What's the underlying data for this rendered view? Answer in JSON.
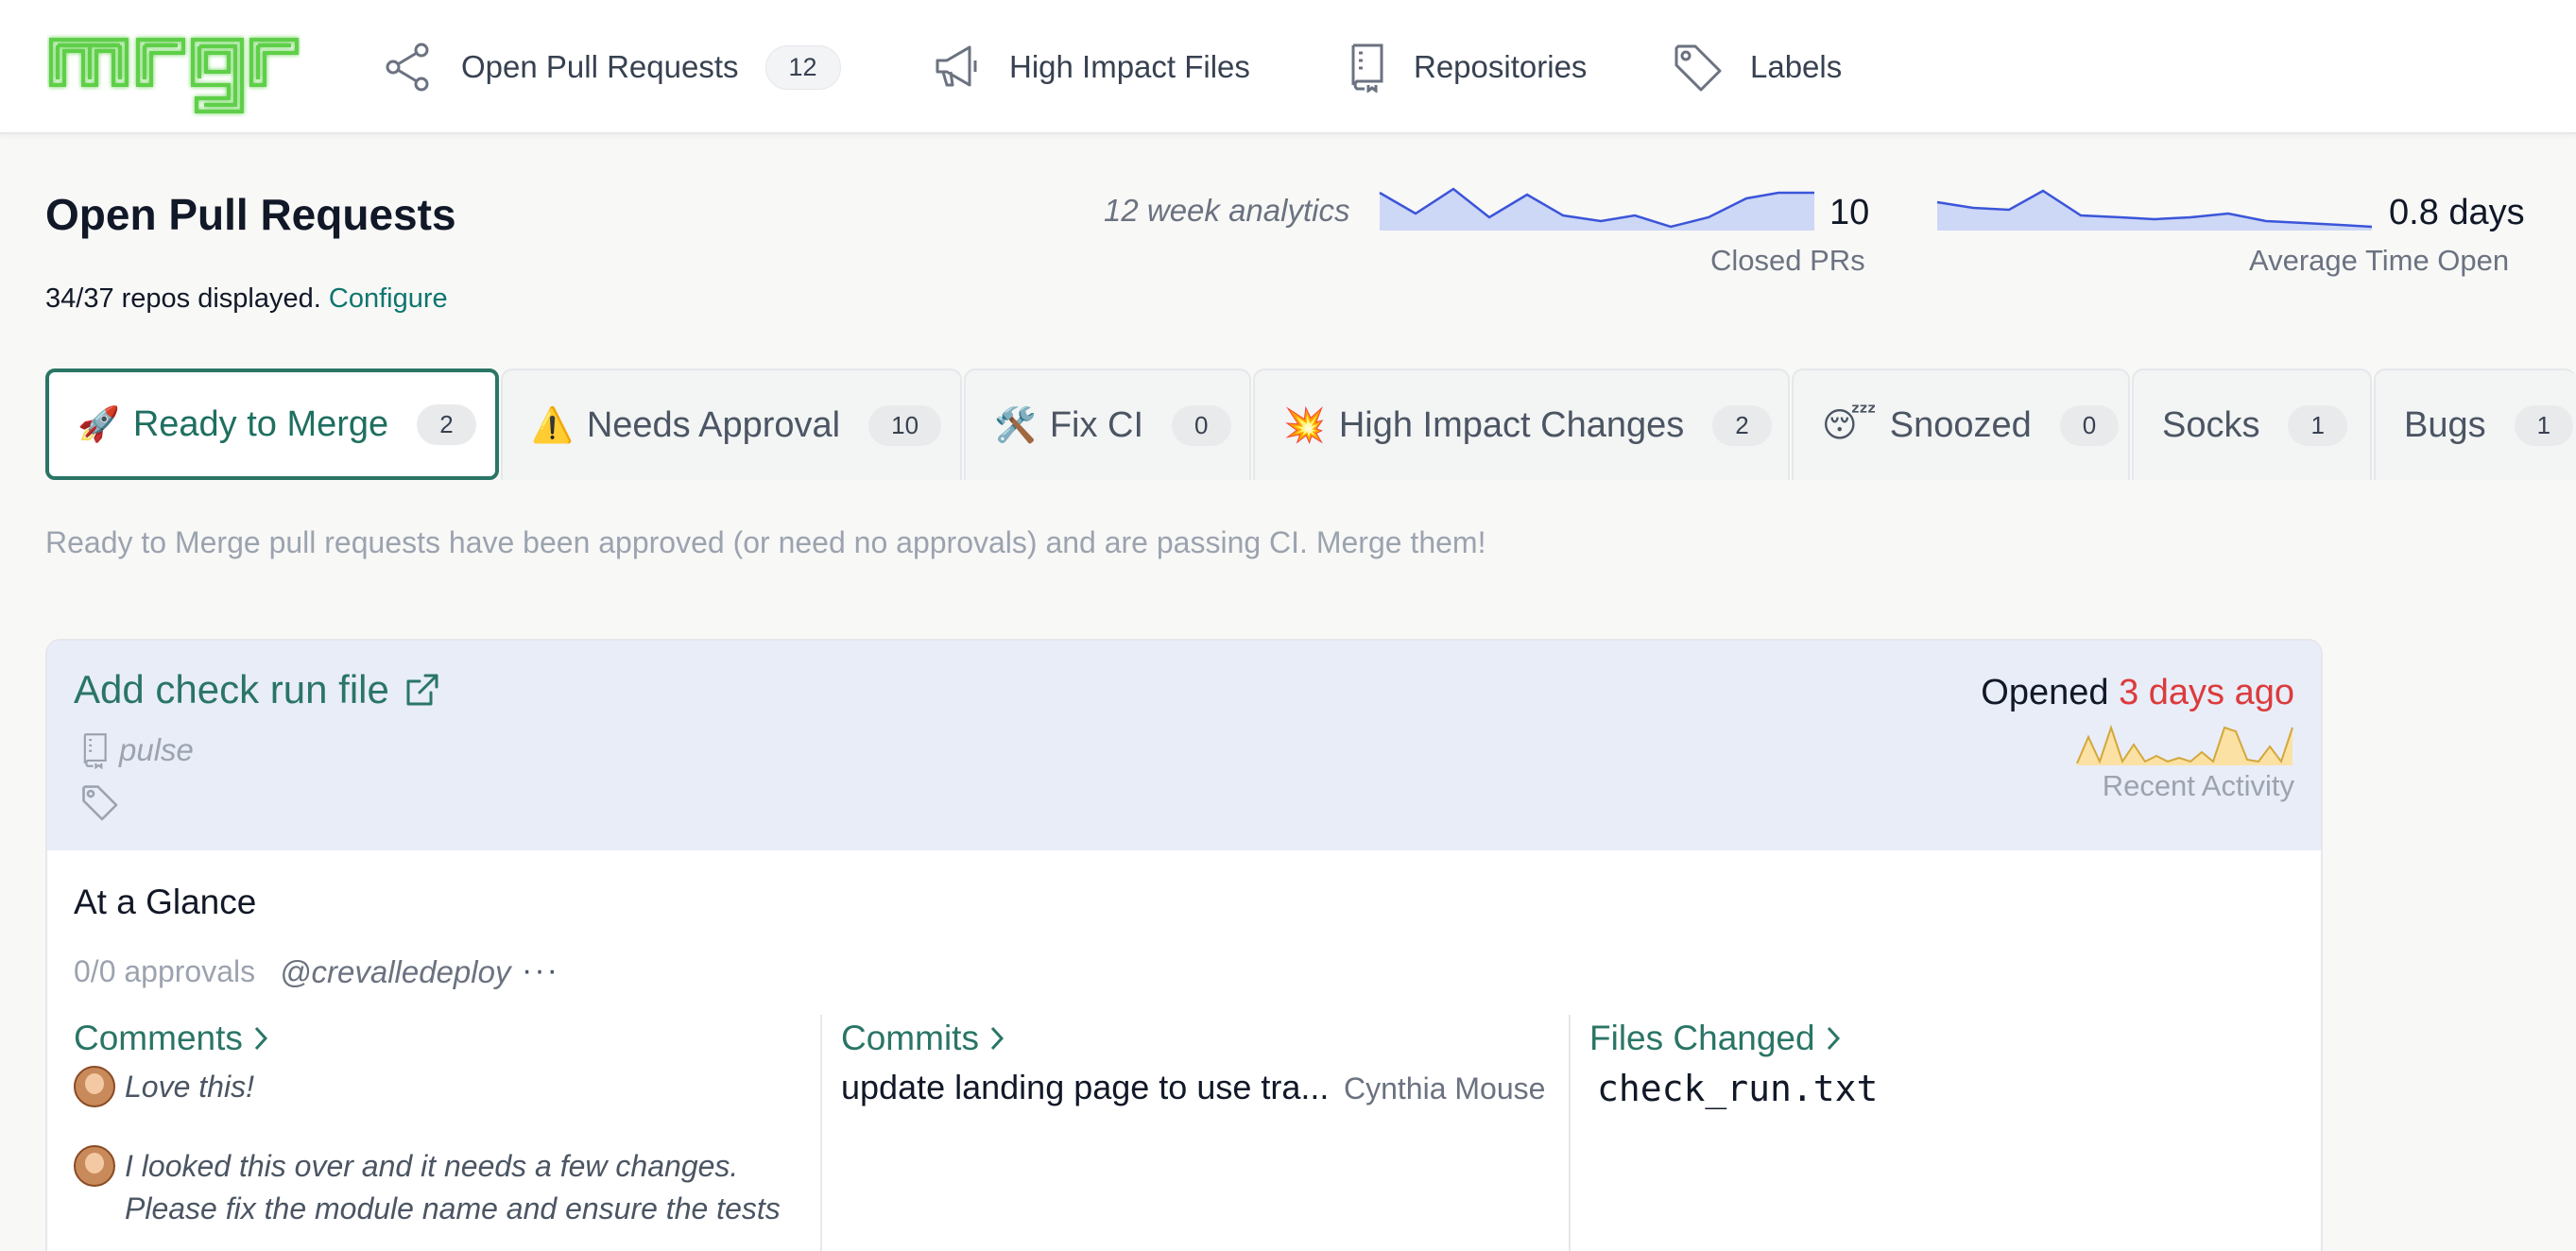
{
  "nav": {
    "logo_text": "mrgr",
    "items": [
      {
        "label": "Open Pull Requests",
        "count": "12",
        "icon": "share-icon"
      },
      {
        "label": "High Impact Files",
        "icon": "megaphone-icon"
      },
      {
        "label": "Repositories",
        "icon": "repo-icon"
      },
      {
        "label": "Labels",
        "icon": "tag-icon"
      }
    ]
  },
  "header": {
    "title": "Open Pull Requests",
    "repos_text": "34/37 repos displayed.",
    "configure_link": "Configure",
    "analytics_label": "12 week analytics",
    "metrics": [
      {
        "value": "10",
        "label": "Closed PRs"
      },
      {
        "value": "0.8 days",
        "label": "Average Time Open"
      }
    ]
  },
  "tabs": [
    {
      "emoji": "🚀",
      "label": "Ready to Merge",
      "count": "2",
      "active": true
    },
    {
      "emoji": "⚠️",
      "label": "Needs Approval",
      "count": "10"
    },
    {
      "emoji": "🛠️",
      "label": "Fix CI",
      "count": "0"
    },
    {
      "emoji": "💥",
      "label": "High Impact Changes",
      "count": "2"
    },
    {
      "emoji": "😴",
      "label": "Snoozed",
      "count": "0"
    },
    {
      "emoji": "",
      "label": "Socks",
      "count": "1"
    },
    {
      "emoji": "",
      "label": "Bugs",
      "count": "1"
    }
  ],
  "description": "Ready to Merge pull requests have been approved (or need no approvals) and are passing CI. Merge them!",
  "card": {
    "title": "Add check run file",
    "repo": "pulse",
    "opened_prefix": "Opened",
    "opened_ago": "3 days ago",
    "activity_label": "Recent Activity",
    "glance_title": "At a Glance",
    "approvals": "0/0 approvals",
    "author": "@crevalledeploy",
    "more": "···",
    "comments_header": "Comments",
    "comments": [
      {
        "lines": [
          "Love this!"
        ]
      },
      {
        "lines": [
          "I looked this over and it needs a few changes.",
          "Please fix the module name and ensure the tests"
        ]
      }
    ],
    "commits_header": "Commits",
    "commit_message": "update landing page to use tra...",
    "commit_author": "Cynthia Mouse",
    "files_header": "Files Changed",
    "file": "check_run.txt"
  },
  "colors": {
    "accent": "#2a7566",
    "danger": "#dc3b3b",
    "spark_line": "#3b55d9",
    "spark_fill": "#cdd7f6",
    "activity_fill": "#fbe2a4",
    "activity_line": "#d4a73a"
  }
}
